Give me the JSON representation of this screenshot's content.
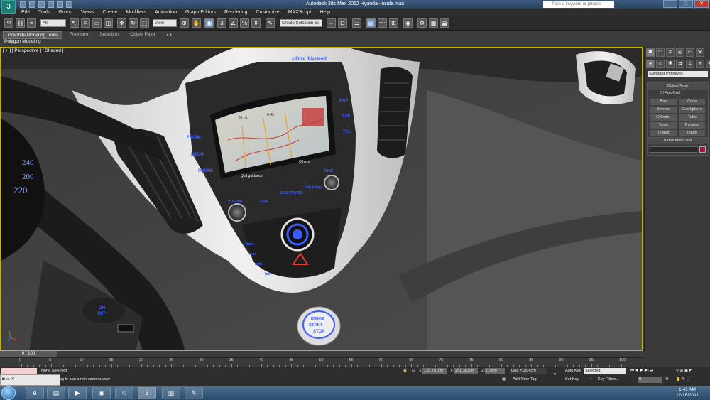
{
  "window": {
    "title": "Autodesk 3ds Max 2012    Hyundai-inside.max",
    "search_placeholder": "Type a keyword or phrase"
  },
  "menu": [
    "Edit",
    "Tools",
    "Group",
    "Views",
    "Create",
    "Modifiers",
    "Animation",
    "Graph Editors",
    "Rendering",
    "Customize",
    "MAXScript",
    "Help"
  ],
  "toolbar": {
    "filter_value": "All",
    "ref_coord_value": "View",
    "selection_set_value": "Create Selection Se"
  },
  "ribbon": {
    "tabs": [
      "Graphite Modeling Tools",
      "Freeform",
      "Selection",
      "Object Paint"
    ],
    "sub_label": "Polygon Modeling"
  },
  "viewport": {
    "label": "[ + ] [ Perspective ] [ Shaded ]",
    "scene": {
      "top_buttons": "cd/dvd  /bluetooth",
      "left_buttons": [
        "FM/AM",
        "MEDIA",
        "PHONE"
      ],
      "right_buttons": [
        "MAP",
        "NAV",
        "TEL"
      ],
      "screen_texts": [
        "Quit guidance",
        "Others",
        "62 mi",
        "6:43"
      ],
      "lower_buttons": [
        "VOLUME",
        "Seek",
        "SEEK TRACK",
        "info setup",
        "TUNE"
      ],
      "climate_left": [
        "front",
        "rear",
        "auto",
        "fan"
      ],
      "speedo": [
        "240",
        "220",
        "200"
      ],
      "steering_button": "ON OFF",
      "start_button": [
        "ENGINE",
        "START",
        "STOP"
      ]
    }
  },
  "command_panel": {
    "category_value": "Standard Primitives",
    "object_type_title": "Object Type",
    "autogrid_label": "AutoGrid",
    "objects": [
      "Box",
      "Cone",
      "Sphere",
      "GeoSphere",
      "Cylinder",
      "Tube",
      "Torus",
      "Pyramid",
      "Teapot",
      "Plane"
    ],
    "name_color_title": "Name and Color",
    "swatch_color": "#a3164f"
  },
  "timeline": {
    "frame_label": "0 / 100",
    "ruler_labels": [
      "0",
      "5",
      "10",
      "15",
      "20",
      "25",
      "30",
      "35",
      "40",
      "45",
      "50",
      "55",
      "60",
      "65",
      "70",
      "75",
      "80",
      "85",
      "90",
      "95",
      "100"
    ]
  },
  "status": {
    "selection": "None Selected",
    "prompt": "rag to pan a non-camera view",
    "x_label": "X:",
    "x_value": "125.781cm",
    "y_label": "Y:",
    "y_value": "251.363cm",
    "z_label": "Z:",
    "z_value": "0.0cm",
    "grid": "Grid = 25.4cm",
    "add_time_tag": "Add Time Tag",
    "auto_key": "Auto Key",
    "auto_key_value": "Selected",
    "set_key": "Set Key",
    "key_filters": "Key Filters...",
    "frame_value": "0"
  },
  "taskbar": {
    "time": "1:41 AM",
    "date": "12/18/2011"
  }
}
